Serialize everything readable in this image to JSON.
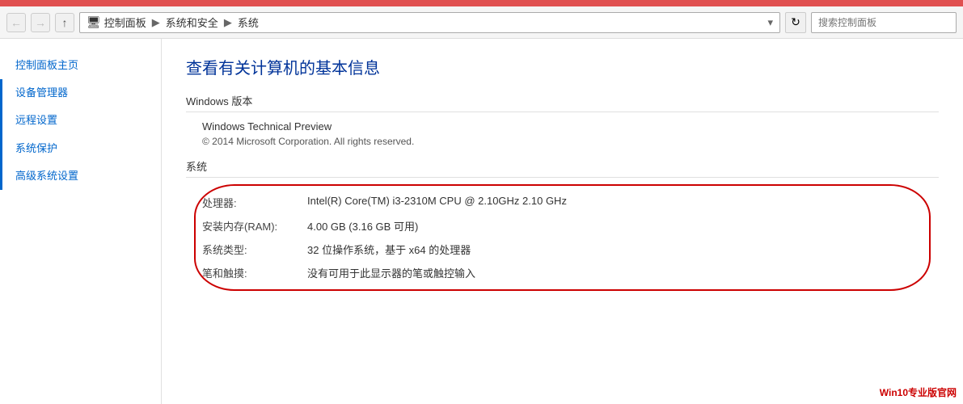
{
  "topbar": {
    "color": "#e05050"
  },
  "addressbar": {
    "back_label": "←",
    "forward_label": "→",
    "up_label": "↑",
    "refresh_label": "↻",
    "breadcrumb": [
      "控制面板",
      "系统和安全",
      "系统"
    ],
    "search_placeholder": "搜索控制面板",
    "dropdown_label": "▾"
  },
  "sidebar": {
    "items": [
      {
        "id": "home",
        "label": "控制面板主页",
        "active": false
      },
      {
        "id": "device-manager",
        "label": "设备管理器",
        "active": false,
        "has_bar": true
      },
      {
        "id": "remote",
        "label": "远程设置",
        "active": false,
        "has_bar": true
      },
      {
        "id": "protection",
        "label": "系统保护",
        "active": false,
        "has_bar": true
      },
      {
        "id": "advanced",
        "label": "高级系统设置",
        "active": false,
        "has_bar": true
      }
    ]
  },
  "content": {
    "page_title": "查看有关计算机的基本信息",
    "windows_version_label": "Windows 版本",
    "windows_name": "Windows Technical Preview",
    "copyright": "© 2014 Microsoft Corporation. All rights reserved.",
    "system_label": "系统",
    "system_rows": [
      {
        "label": "处理器:",
        "value": "Intel(R) Core(TM) i3-2310M CPU @ 2.10GHz   2.10 GHz"
      },
      {
        "label": "安装内存(RAM):",
        "value": "4.00 GB (3.16 GB 可用)"
      },
      {
        "label": "系统类型:",
        "value": "32 位操作系统，基于 x64 的处理器"
      },
      {
        "label": "笔和触摸:",
        "value": "没有可用于此显示器的笔或触控输入"
      }
    ]
  },
  "watermark": {
    "text": "Win10专业版官网"
  }
}
